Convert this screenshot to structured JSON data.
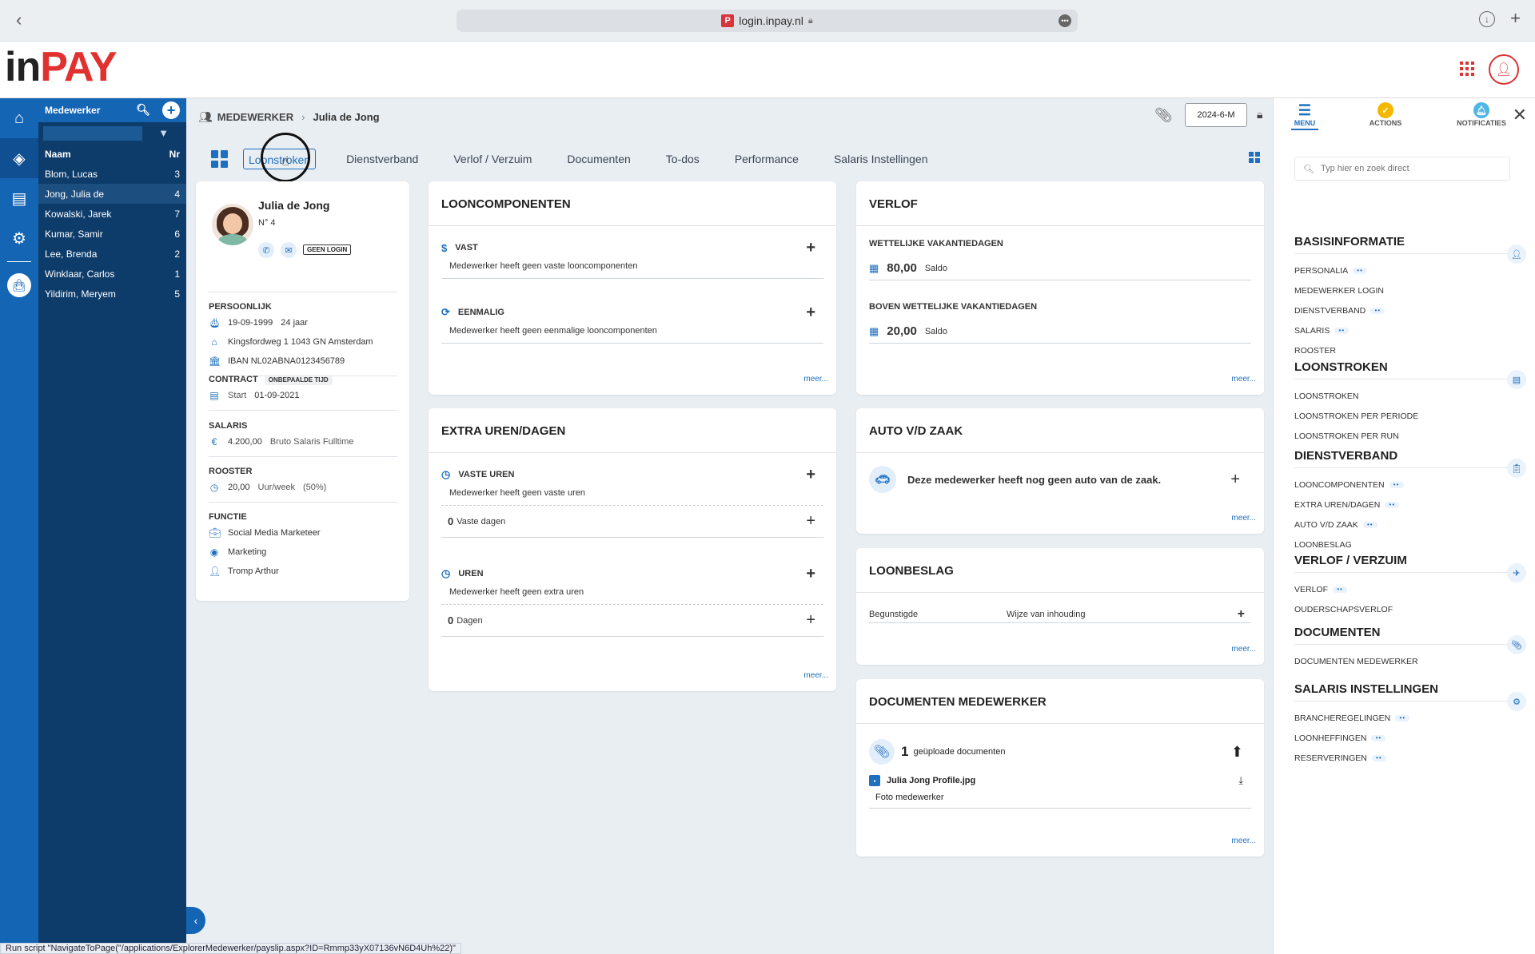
{
  "browser": {
    "url": "login.inpay.nl",
    "favicon": "P"
  },
  "brand": {
    "in": "in",
    "pay": "PAY"
  },
  "employees": {
    "title": "Medewerker",
    "col_name": "Naam",
    "col_nr": "Nr",
    "rows": [
      {
        "name": "Blom, Lucas",
        "nr": "3"
      },
      {
        "name": "Jong, Julia de",
        "nr": "4"
      },
      {
        "name": "Kowalski, Jarek",
        "nr": "7"
      },
      {
        "name": "Kumar, Samir",
        "nr": "6"
      },
      {
        "name": "Lee, Brenda",
        "nr": "2"
      },
      {
        "name": "Winklaar, Carlos",
        "nr": "1"
      },
      {
        "name": "Yildirim, Meryem",
        "nr": "5"
      }
    ]
  },
  "breadcrumb": {
    "section": "MEDEWERKER",
    "current": "Julia de Jong"
  },
  "period": "2024-6-M",
  "tabs": [
    "Loonstroken",
    "Dienstverband",
    "Verlof / Verzuim",
    "Documenten",
    "To-dos",
    "Performance",
    "Salaris Instellingen"
  ],
  "profile": {
    "name": "Julia de Jong",
    "nr": "N° 4",
    "login_badge": "GEEN LOGIN",
    "persoonlijk_label": "PERSOONLIJK",
    "birth": "19-09-1999",
    "age": "24 jaar",
    "address": "Kingsfordweg 1 1043 GN Amsterdam",
    "iban": "IBAN NL02ABNA0123456789",
    "contract_label": "CONTRACT",
    "contract_type": "ONBEPAALDE TIJD",
    "start_label": "Start",
    "start_date": "01-09-2021",
    "salaris_label": "SALARIS",
    "salary": "4.200,00",
    "salary_desc": "Bruto Salaris Fulltime",
    "rooster_label": "ROOSTER",
    "hours": "20,00",
    "hours_unit": "Uur/week",
    "hours_pct": "(50%)",
    "functie_label": "FUNCTIE",
    "function": "Social Media Marketeer",
    "department": "Marketing",
    "manager": "Tromp Arthur"
  },
  "looncomponenten": {
    "title": "LOONCOMPONENTEN",
    "vast_label": "VAST",
    "vast_text": "Medewerker heeft geen vaste looncomponenten",
    "eenmalig_label": "EENMALIG",
    "eenmalig_text": "Medewerker heeft geen eenmalige looncomponenten",
    "meer": "meer..."
  },
  "extra": {
    "title": "EXTRA UREN/DAGEN",
    "vaste_label": "VASTE UREN",
    "vaste_text": "Medewerker heeft geen vaste uren",
    "vaste_dagen_n": "0",
    "vaste_dagen_label": "Vaste dagen",
    "uren_label": "UREN",
    "uren_text": "Medewerker heeft geen extra uren",
    "dagen_n": "0",
    "dagen_label": "Dagen",
    "meer": "meer..."
  },
  "verlof": {
    "title": "VERLOF",
    "wet_label": "WETTELIJKE VAKANTIEDAGEN",
    "wet_value": "80,00",
    "wet_unit": "Saldo",
    "boven_label": "BOVEN WETTELIJKE VAKANTIEDAGEN",
    "boven_value": "20,00",
    "boven_unit": "Saldo",
    "meer": "meer..."
  },
  "auto": {
    "title": "AUTO V/D ZAAK",
    "text": "Deze medewerker heeft nog geen auto van de zaak.",
    "meer": "meer..."
  },
  "loonbeslag": {
    "title": "LOONBESLAG",
    "col1": "Begunstigde",
    "col2": "Wijze van inhouding",
    "meer": "meer..."
  },
  "documenten": {
    "title": "DOCUMENTEN MEDEWERKER",
    "count": "1",
    "count_label": "geüploade documenten",
    "file": "Julia Jong Profile.jpg",
    "file_desc": "Foto medewerker",
    "meer": "meer..."
  },
  "right_panel": {
    "tabs": [
      "MENU",
      "ACTIONS",
      "NOTIFICATIES"
    ],
    "search_placeholder": "Typ hier en zoek direct",
    "sections": [
      {
        "title": "BASISINFORMATIE",
        "items": [
          {
            "l": "PERSONALIA",
            "d": true
          },
          {
            "l": "MEDEWERKER LOGIN",
            "d": false
          },
          {
            "l": "DIENSTVERBAND",
            "d": true
          },
          {
            "l": "SALARIS",
            "d": true
          },
          {
            "l": "ROOSTER",
            "d": false
          }
        ]
      },
      {
        "title": "LOONSTROKEN",
        "items": [
          {
            "l": "LOONSTROKEN",
            "d": false
          },
          {
            "l": "LOONSTROKEN PER PERIODE",
            "d": false
          },
          {
            "l": "LOONSTROKEN PER RUN",
            "d": false
          }
        ]
      },
      {
        "title": "DIENSTVERBAND",
        "items": [
          {
            "l": "LOONCOMPONENTEN",
            "d": true
          },
          {
            "l": "EXTRA UREN/DAGEN",
            "d": true
          },
          {
            "l": "AUTO V/D ZAAK",
            "d": true
          },
          {
            "l": "LOONBESLAG",
            "d": false
          }
        ]
      },
      {
        "title": "VERLOF / VERZUIM",
        "items": [
          {
            "l": "VERLOF",
            "d": true
          },
          {
            "l": "OUDERSCHAPSVERLOF",
            "d": false
          }
        ]
      },
      {
        "title": "DOCUMENTEN",
        "items": [
          {
            "l": "DOCUMENTEN MEDEWERKER",
            "d": false
          }
        ]
      },
      {
        "title": "SALARIS INSTELLINGEN",
        "items": [
          {
            "l": "BRANCHEREGELINGEN",
            "d": true
          },
          {
            "l": "LOONHEFFINGEN",
            "d": true
          },
          {
            "l": "RESERVERINGEN",
            "d": true
          }
        ]
      }
    ]
  },
  "status_bar": "Run script \"NavigateToPage(\"/applications/ExplorerMedewerker/payslip.aspx?ID=Rmmp33yX07136vN6D4Uh%22)\"",
  "colors": {
    "brand_red": "#e0312e",
    "primary_blue": "#1565b5",
    "sidebar_dark": "#0d3c6b",
    "actions_badge": "#f5b800",
    "notif_badge": "#4fb6e8"
  }
}
